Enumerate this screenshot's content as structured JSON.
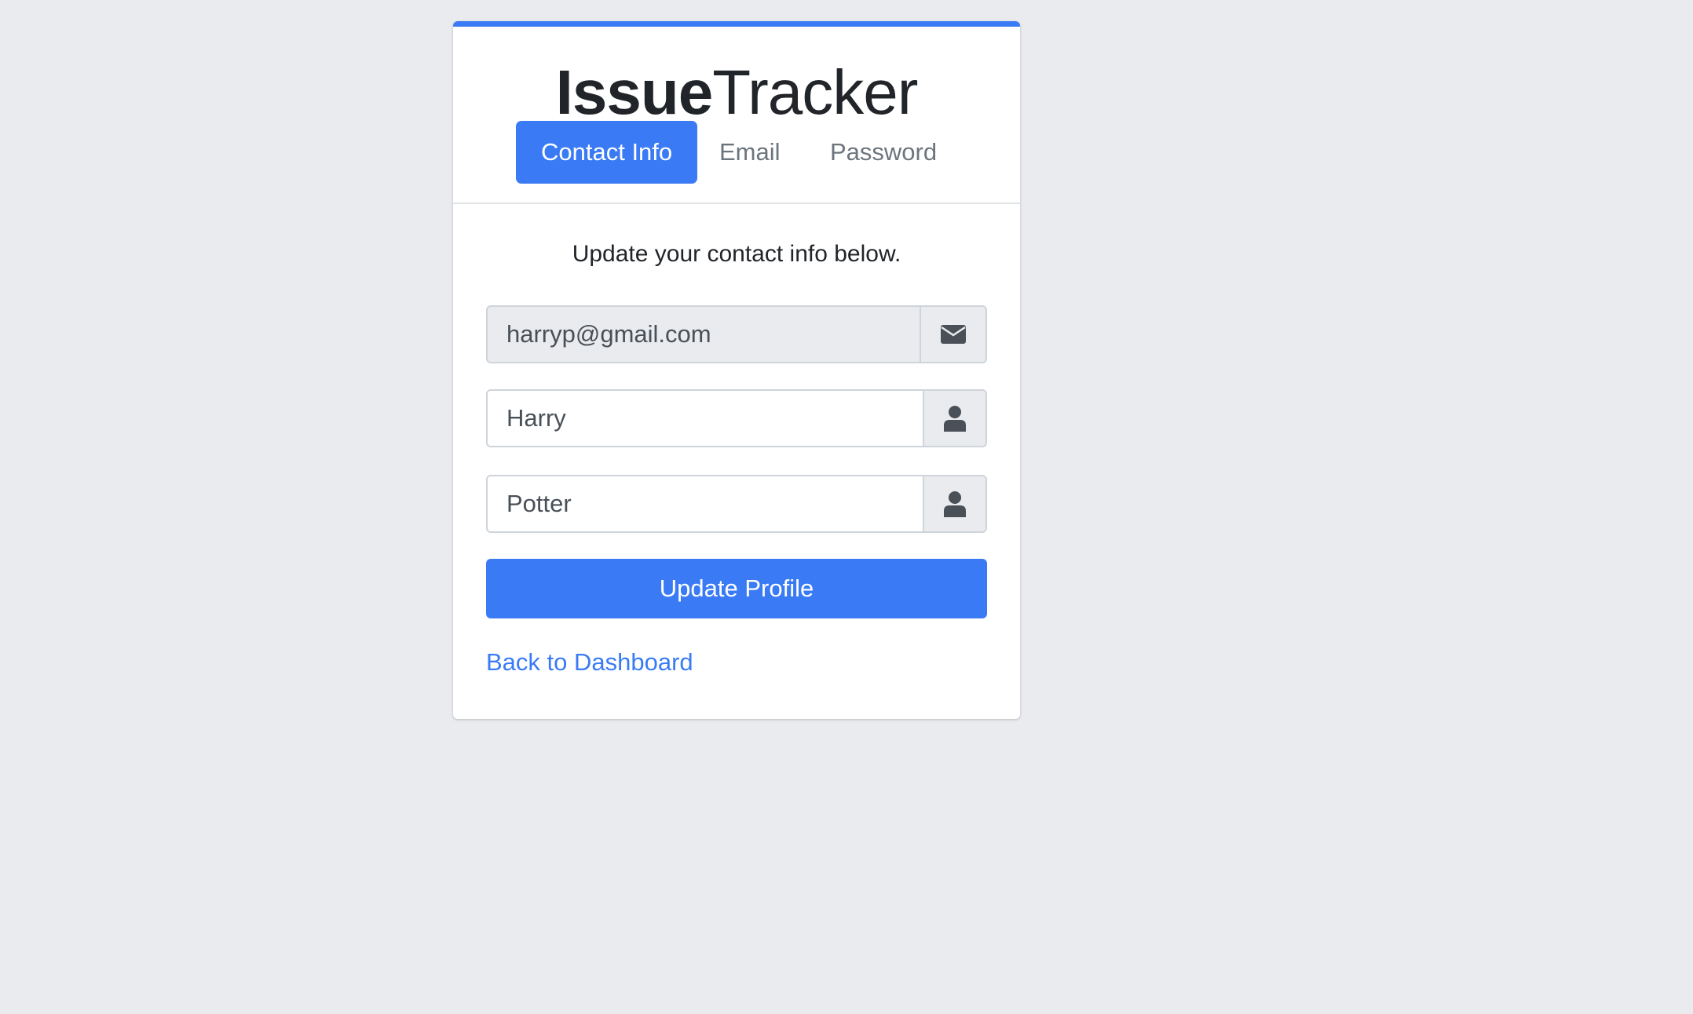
{
  "app": {
    "title_bold": "Issue",
    "title_light": "Tracker",
    "accent_color": "#3a7bf5"
  },
  "tabs": [
    {
      "label": "Contact Info",
      "active": true
    },
    {
      "label": "Email",
      "active": false
    },
    {
      "label": "Password",
      "active": false
    }
  ],
  "form": {
    "subtitle": "Update your contact info below.",
    "email": {
      "value": "harryp@gmail.com",
      "readonly": true,
      "icon": "envelope-icon"
    },
    "first_name": {
      "value": "Harry",
      "icon": "user-icon"
    },
    "last_name": {
      "value": "Potter",
      "icon": "user-icon"
    },
    "submit_label": "Update Profile"
  },
  "footer": {
    "back_link": "Back to Dashboard"
  }
}
